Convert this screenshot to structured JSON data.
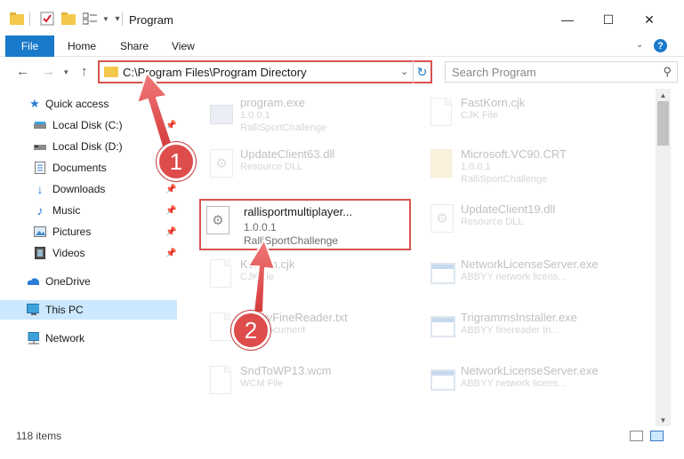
{
  "window": {
    "title": "Program",
    "minimize_glyph": "—",
    "maximize_glyph": "☐",
    "close_glyph": "✕"
  },
  "ribbon": {
    "file_tab": "File",
    "tabs": [
      "Home",
      "Share",
      "View"
    ],
    "help_glyph": "?"
  },
  "nav": {
    "address_path": "C:\\Program Files\\Program Directory",
    "search_placeholder": "Search Program"
  },
  "sidebar": {
    "items": [
      {
        "label": "Quick access",
        "icon": "star-icon",
        "pinned": false
      },
      {
        "label": "Local Disk (C:)",
        "icon": "drive-icon",
        "pinned": true
      },
      {
        "label": "Local Disk (D:)",
        "icon": "drive-icon",
        "pinned": false
      },
      {
        "label": "Documents",
        "icon": "documents-icon",
        "pinned": true
      },
      {
        "label": "Downloads",
        "icon": "download-icon",
        "pinned": true
      },
      {
        "label": "Music",
        "icon": "music-icon",
        "pinned": true
      },
      {
        "label": "Pictures",
        "icon": "pictures-icon",
        "pinned": true
      },
      {
        "label": "Videos",
        "icon": "videos-icon",
        "pinned": true
      },
      {
        "label": "OneDrive",
        "icon": "cloud-icon",
        "pinned": false
      },
      {
        "label": "This PC",
        "icon": "computer-icon",
        "pinned": false,
        "selected": true
      },
      {
        "label": "Network",
        "icon": "network-icon",
        "pinned": false
      }
    ]
  },
  "files": {
    "left": [
      {
        "name": "program.exe",
        "line2": "1.0.0.1",
        "line3": "RalliSportChallenge",
        "icon": "exe-icon",
        "faded": true
      },
      {
        "name": "UpdateClient63.dll",
        "line2": "Resource DLL",
        "line3": "",
        "icon": "gear-file-icon",
        "faded": true
      },
      {
        "name": "rallisportmultiplayer...",
        "line2": "1.0.0.1",
        "line3": "RalliSportChallenge",
        "icon": "gear-file-icon",
        "faded": false,
        "highlighted": true
      },
      {
        "name": "Korean.cjk",
        "line2": "CJK file",
        "line3": "",
        "icon": "document-icon",
        "faded": true
      },
      {
        "name": "AbbyyFineReader.txt",
        "line2": "Text Document",
        "line3": "",
        "icon": "document-icon",
        "faded": true
      },
      {
        "name": "SndToWP13.wcm",
        "line2": "WCM File",
        "line3": "",
        "icon": "document-icon",
        "faded": true
      }
    ],
    "right": [
      {
        "name": "FastKorn.cjk",
        "line2": "CJK File",
        "line3": "",
        "icon": "document-icon"
      },
      {
        "name": "Microsoft.VC90.CRT",
        "line2": "1.0.0.1",
        "line3": "RalliSportChallenge",
        "icon": "folder-document-icon"
      },
      {
        "name": "UpdateClient19.dll",
        "line2": "Resource DLL",
        "line3": "",
        "icon": "gear-file-icon"
      },
      {
        "name": "NetworkLicenseServer.exe",
        "line2": "ABBYY network licens...",
        "line3": "",
        "icon": "app-icon"
      },
      {
        "name": "TrigrammsInstaller.exe",
        "line2": "ABBYY finereader tri...",
        "line3": "",
        "icon": "app-icon"
      },
      {
        "name": "NetworkLicenseServer.exe",
        "line2": "ABBYY network licens...",
        "line3": "",
        "icon": "app-icon"
      }
    ]
  },
  "status": {
    "item_count": "118 items"
  },
  "annotations": {
    "badge1": "1",
    "badge2": "2",
    "color": "#de4c4c"
  }
}
